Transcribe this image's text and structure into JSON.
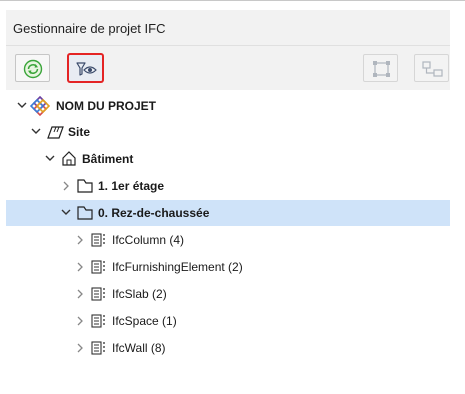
{
  "panel": {
    "title": "Gestionnaire de projet IFC"
  },
  "toolbar": {
    "refresh_icon": "refresh-icon",
    "filter_icon": "filter-eye-icon",
    "button3_icon": "structure-icon",
    "button4_icon": "hierarchy-icon"
  },
  "tree": {
    "project": "NOM DU PROJET",
    "site": "Site",
    "building": "Bâtiment",
    "floor1": "1. 1er étage",
    "floor0": "0. Rez-de-chaussée",
    "items": [
      "IfcColumn (4)",
      "IfcFurnishingElement (2)",
      "IfcSlab (2)",
      "IfcSpace (1)",
      "IfcWall (8)"
    ]
  },
  "colors": {
    "selection": "#cfe3f9",
    "active_border": "#e42424",
    "refresh_green": "#3aa53a"
  }
}
